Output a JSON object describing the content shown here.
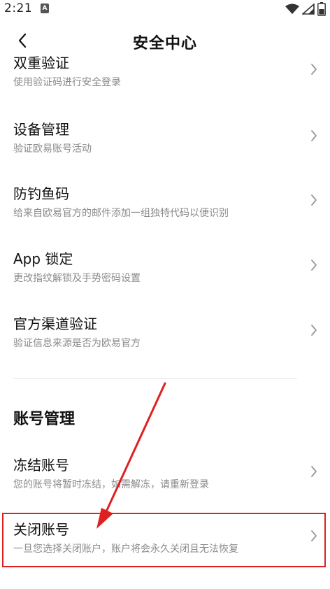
{
  "status_bar": {
    "time": "2:21",
    "app_icon_glyph": "A",
    "icons": [
      "wifi-icon",
      "signal-icon",
      "battery-icon"
    ]
  },
  "header": {
    "title": "安全中心",
    "back_icon": "chevron-left-icon"
  },
  "security_items": [
    {
      "title": "双重验证",
      "subtitle": "使用验证码进行安全登录"
    },
    {
      "title": "设备管理",
      "subtitle": "验证欧易账号活动"
    },
    {
      "title": "防钓鱼码",
      "subtitle": "给来自欧易官方的邮件添加一组独特代码以便识别"
    },
    {
      "title": "App 锁定",
      "subtitle": "更改指纹解锁及手势密码设置"
    },
    {
      "title": "官方渠道验证",
      "subtitle": "验证信息来源是否为欧易官方"
    }
  ],
  "account_section": {
    "title": "账号管理",
    "items": [
      {
        "title": "冻结账号",
        "subtitle": "您的账号将暂时冻结，如需解冻，请重新登录"
      },
      {
        "title": "关闭账号",
        "subtitle": "一旦您选择关闭账户，账户将会永久关闭且无法恢复"
      }
    ]
  },
  "colors": {
    "annotation": "#e02020",
    "subtitle": "#8a8a8a",
    "chevron": "#999999"
  }
}
